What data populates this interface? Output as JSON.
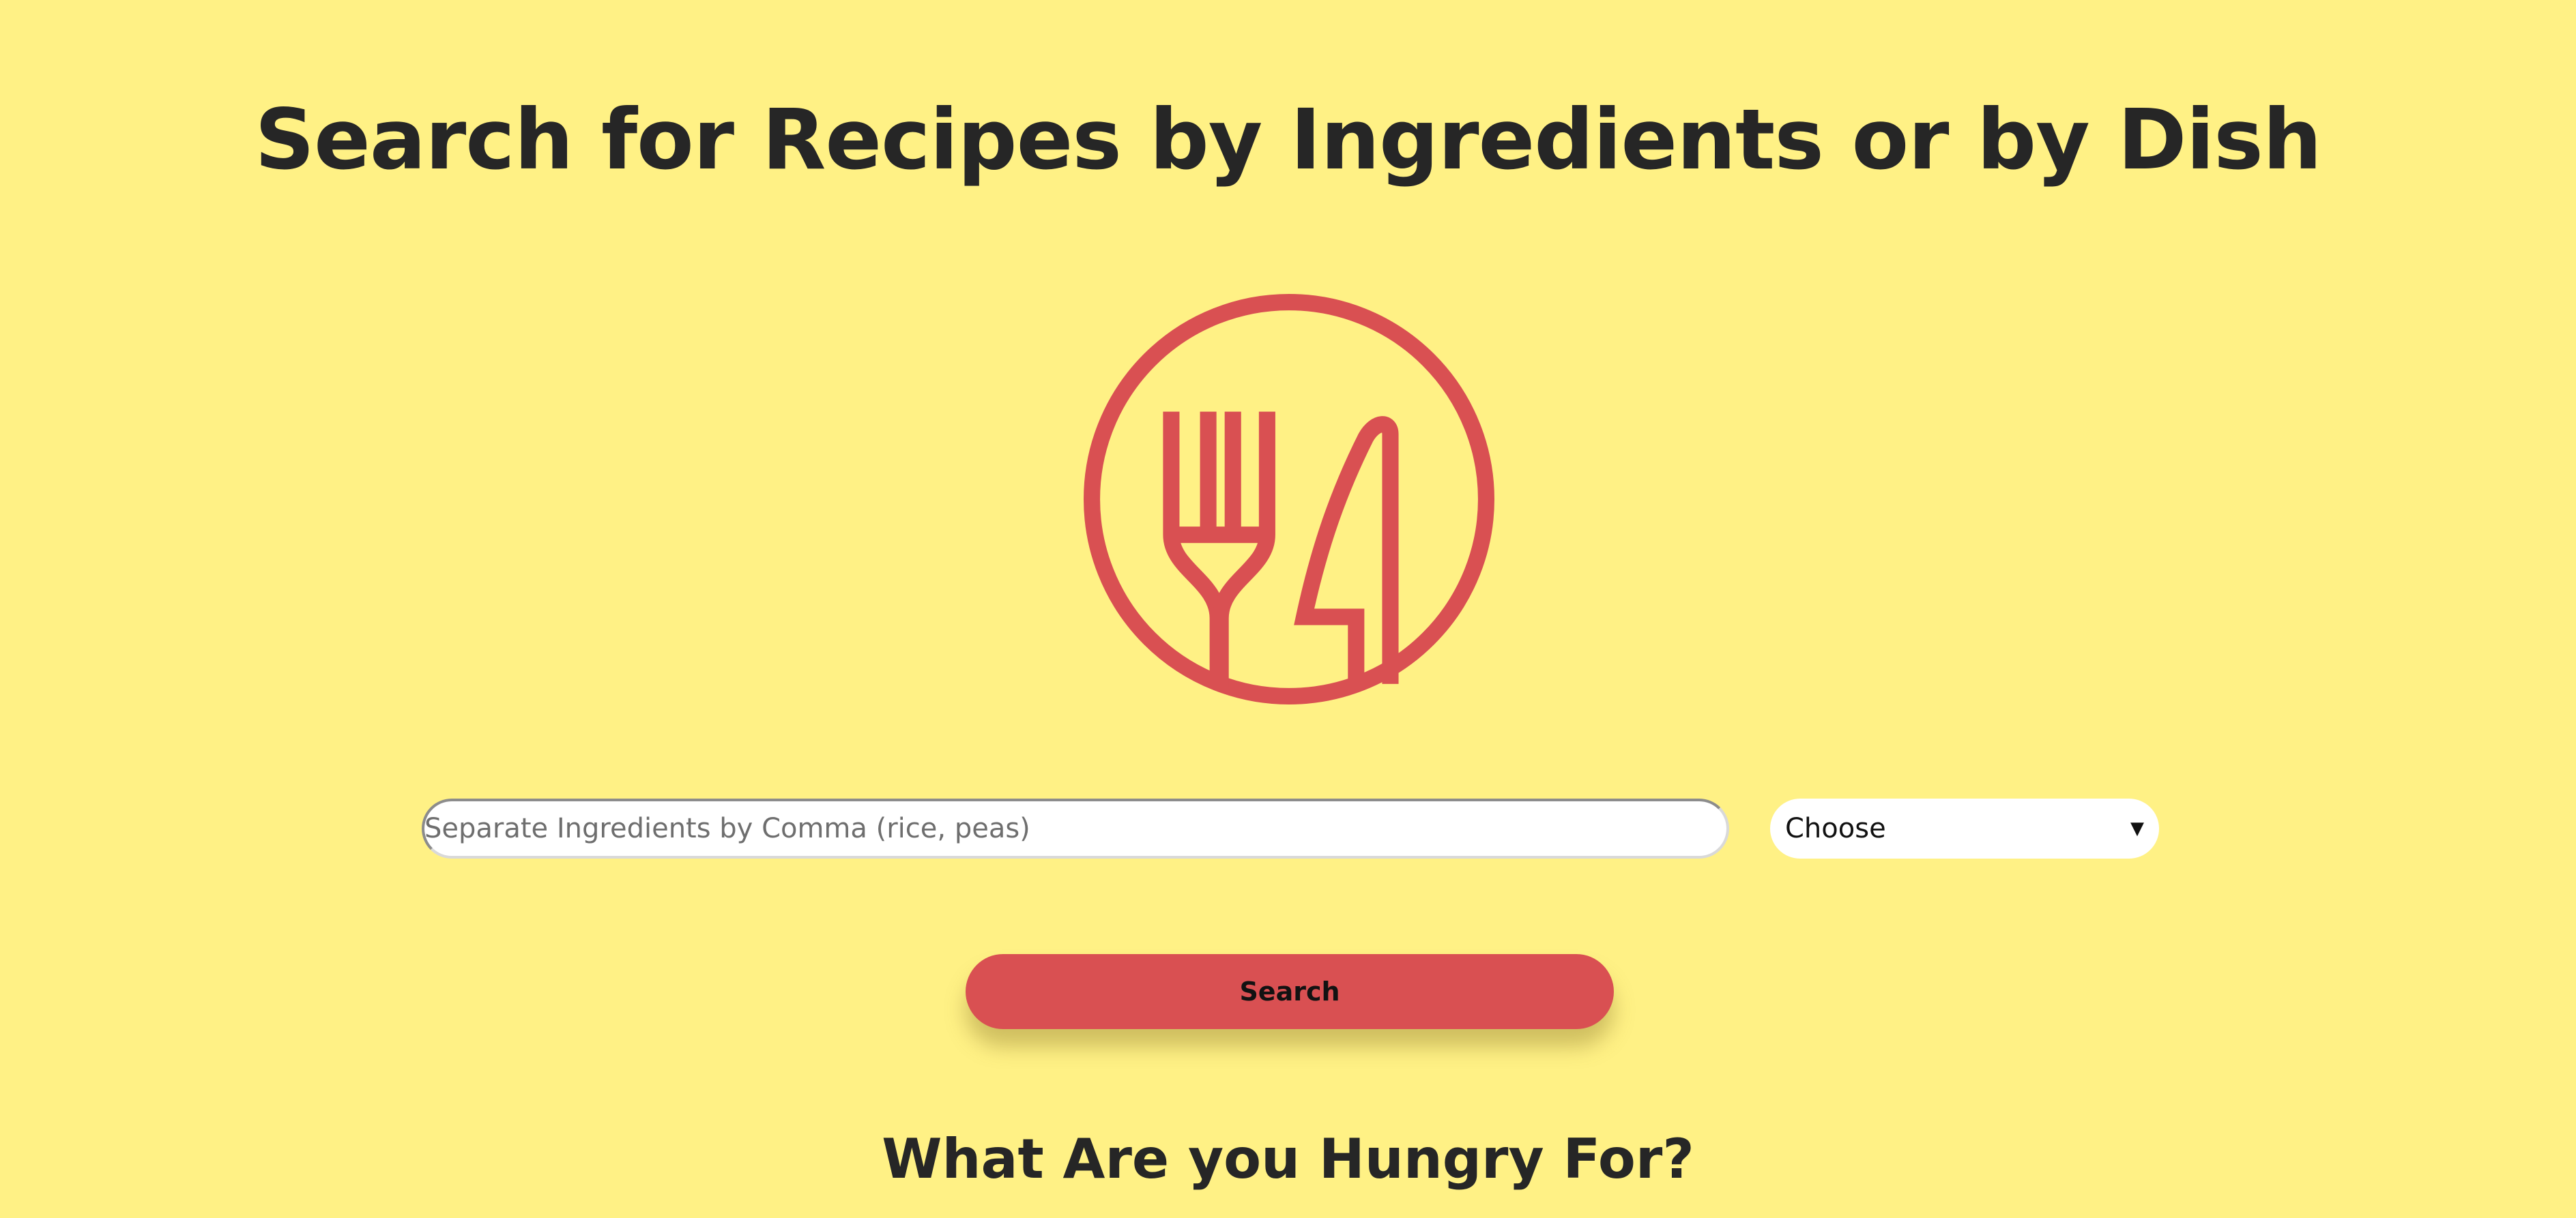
{
  "header": {
    "title": "Search for Recipes by Ingredients or by Dish"
  },
  "logo": {
    "icon": "fork-and-knife-icon",
    "color": "#d95052"
  },
  "search": {
    "placeholder": "Separate Ingredients by Comma (rice, peas)",
    "value": "",
    "dish_select": {
      "selected": "Choose",
      "arrow": "▼"
    },
    "button_label": "Search"
  },
  "section": {
    "heading": "What Are you Hungry For?"
  },
  "colors": {
    "background": "#fff185",
    "accent": "#d95052",
    "text": "#262626"
  }
}
